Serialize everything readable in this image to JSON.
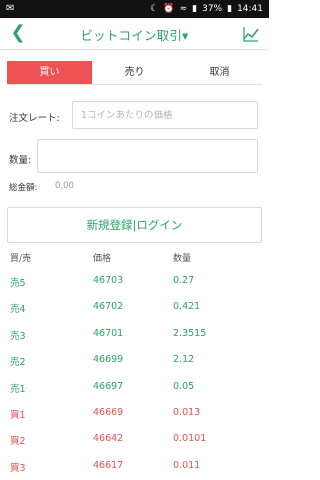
{
  "status_bar": {
    "battery": "37%",
    "time": "14:41"
  },
  "app_bar": {
    "title": "ビットコイン取引▾",
    "back_icon": "back-arrow-icon",
    "chart_icon": "line-chart-icon"
  },
  "segments": [
    {
      "label": "買い",
      "active": true
    },
    {
      "label": "売り",
      "active": false
    },
    {
      "label": "取消",
      "active": false
    }
  ],
  "form": {
    "rate_label": "注文レート:",
    "rate_placeholder": "1コインあたりの価格",
    "qty_label": "数量:",
    "total_label": "総金額:",
    "total_value": "0.00",
    "submit_label": "新規登録|ログイン"
  },
  "order_book": {
    "headers": {
      "side": "買/売",
      "price": "価格",
      "amount": "数量"
    },
    "rows": [
      {
        "side": "売5",
        "price": "46703",
        "amount": "0.27",
        "type": "sell"
      },
      {
        "side": "売4",
        "price": "46702",
        "amount": "0.421",
        "type": "sell"
      },
      {
        "side": "売3",
        "price": "46701",
        "amount": "2.3515",
        "type": "sell"
      },
      {
        "side": "売2",
        "price": "46699",
        "amount": "2.12",
        "type": "sell"
      },
      {
        "side": "売1",
        "price": "46697",
        "amount": "0.05",
        "type": "sell"
      },
      {
        "side": "買1",
        "price": "46669",
        "amount": "0.013",
        "type": "buy"
      },
      {
        "side": "買2",
        "price": "46642",
        "amount": "0.0101",
        "type": "buy"
      },
      {
        "side": "買3",
        "price": "46617",
        "amount": "0.011",
        "type": "buy"
      }
    ]
  },
  "colors": {
    "green": "#2aa364",
    "red": "#ef5254"
  }
}
